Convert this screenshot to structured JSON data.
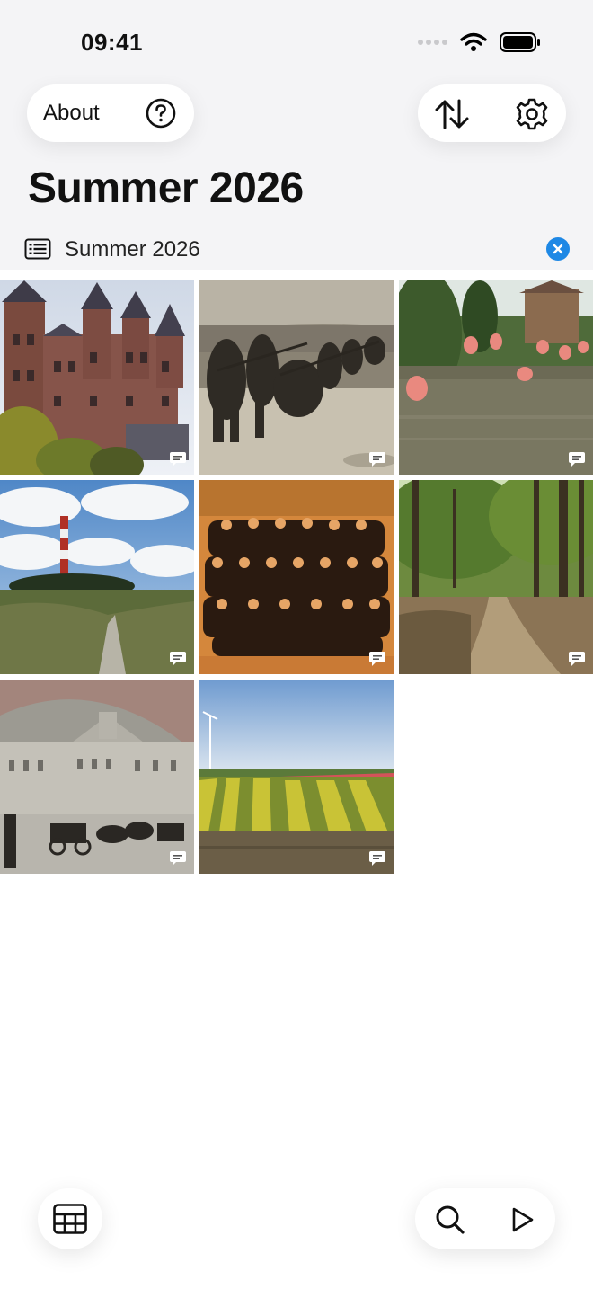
{
  "status_bar": {
    "time": "09:41"
  },
  "header": {
    "about_label": "About",
    "title": "Summer 2026"
  },
  "album_filter": {
    "label": "Summer 2026"
  },
  "photos": [
    {
      "subject": "castle",
      "has_caption": true
    },
    {
      "subject": "soldiers-trench",
      "has_caption": true
    },
    {
      "subject": "flamingos",
      "has_caption": true
    },
    {
      "subject": "lighthouse-dunes",
      "has_caption": true
    },
    {
      "subject": "uniformed-group-sepia",
      "has_caption": true
    },
    {
      "subject": "forest-path",
      "has_caption": true
    },
    {
      "subject": "palace-carriages",
      "has_caption": true
    },
    {
      "subject": "tulip-fields",
      "has_caption": true
    }
  ],
  "colors": {
    "accent": "#1e88e5",
    "background": "#f4f4f6"
  }
}
